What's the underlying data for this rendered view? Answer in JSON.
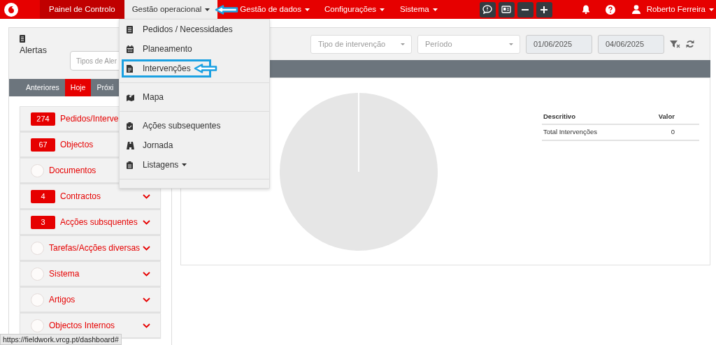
{
  "nav": {
    "items": [
      {
        "label": "Painel de Controlo",
        "selected": true,
        "open": false,
        "dropdown": false
      },
      {
        "label": "Gestão operacional",
        "selected": false,
        "open": true,
        "dropdown": true
      },
      {
        "label": "Gestão de dados",
        "selected": false,
        "open": false,
        "dropdown": true
      },
      {
        "label": "Configurações",
        "selected": false,
        "open": false,
        "dropdown": true
      },
      {
        "label": "Sistema",
        "selected": false,
        "open": false,
        "dropdown": true
      }
    ],
    "user": "Roberto Ferreira"
  },
  "dropdown_menu": {
    "items": [
      {
        "kind": "item",
        "label": "Pedidos / Necessidades",
        "highlighted": false,
        "submenu": false
      },
      {
        "kind": "item",
        "label": "Planeamento",
        "highlighted": false,
        "submenu": false
      },
      {
        "kind": "item",
        "label": "Intervenções",
        "highlighted": true,
        "submenu": false
      },
      {
        "kind": "divider"
      },
      {
        "kind": "item",
        "label": "Mapa",
        "highlighted": false,
        "submenu": false
      },
      {
        "kind": "divider"
      },
      {
        "kind": "item",
        "label": "Ações subsequentes",
        "highlighted": false,
        "submenu": false
      },
      {
        "kind": "item",
        "label": "Jornada",
        "highlighted": false,
        "submenu": false
      },
      {
        "kind": "item",
        "label": "Listagens",
        "highlighted": false,
        "submenu": true
      },
      {
        "kind": "divider"
      }
    ]
  },
  "alerts": {
    "title": "Alertas",
    "type_select": {
      "placeholder": "Tipos de Aler"
    },
    "tabs": [
      {
        "label": "Anteriores",
        "selected": false
      },
      {
        "label": "Hoje",
        "selected": true
      },
      {
        "label": "Próxi",
        "selected": false
      }
    ],
    "items": [
      {
        "kind": "badge",
        "count": "274",
        "label": "Pedidos/Interve"
      },
      {
        "kind": "badge",
        "count": "67",
        "label": "Objectos"
      },
      {
        "kind": "empty",
        "label": "Documentos"
      },
      {
        "kind": "badge",
        "count": "4",
        "label": "Contractos",
        "expanded": false
      },
      {
        "kind": "badge",
        "count": "3",
        "label": "Acções subsquentes",
        "expanded": false
      },
      {
        "kind": "empty",
        "label": "Tarefas/Acções diversas",
        "expanded": false
      },
      {
        "kind": "empty",
        "label": "Sistema",
        "expanded": false
      },
      {
        "kind": "empty",
        "label": "Artigos",
        "expanded": false
      },
      {
        "kind": "empty",
        "label": "Objectos Internos",
        "expanded": false
      }
    ]
  },
  "filters": {
    "type_select": {
      "placeholder": "Tipo de intervenção"
    },
    "period_select": {
      "placeholder": "Período"
    },
    "date_from": "01/06/2025",
    "date_to": "04/06/2025"
  },
  "summary_table": {
    "columns": [
      "Descritivo",
      "Valor"
    ],
    "rows": [
      [
        "Total Intervenções",
        "0"
      ]
    ]
  },
  "status_bar": "https://fieldwork.vrcg.pt/dashboard#"
}
